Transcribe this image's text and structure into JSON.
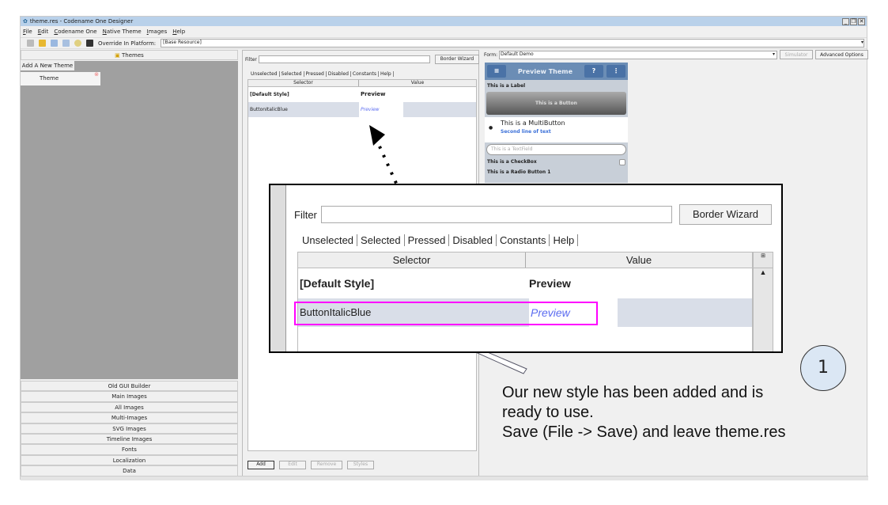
{
  "window": {
    "title": "theme.res - Codename One Designer",
    "controls": [
      "_",
      "❐",
      "✕"
    ]
  },
  "menu": [
    "File",
    "Edit",
    "Codename One",
    "Native Theme",
    "Images",
    "Help"
  ],
  "toolbar": {
    "platform_label": "Override In Platform:",
    "platform_value": "[Base Resource]"
  },
  "left": {
    "header": "Themes",
    "add_tab": "Add A New Theme",
    "theme_item": "Theme",
    "items": [
      "Old GUI Builder",
      "Main Images",
      "All Images",
      "Multi-Images",
      "SVG Images",
      "Timeline Images",
      "Fonts",
      "Localization",
      "Data"
    ]
  },
  "editor": {
    "filter_label": "Filter",
    "filter_value": "",
    "border_wizard": "Border Wizard",
    "tabs": [
      "Unselected",
      "Selected",
      "Pressed",
      "Disabled",
      "Constants",
      "Help"
    ],
    "columns": [
      "Selector",
      "Value"
    ],
    "rows": [
      {
        "selector": "[Default Style]",
        "value": "Preview"
      },
      {
        "selector": "ButtonItalicBlue",
        "value": "Preview"
      }
    ],
    "buttons": [
      "Add",
      "Edit",
      "Remove",
      "Styles"
    ]
  },
  "right": {
    "form_label": "Form:",
    "form_value": "Default Demo",
    "simulator": "Simulator",
    "advanced": "Advanced Options",
    "preview": {
      "title": "Preview Theme",
      "label": "This is a Label",
      "button": "This is a Button",
      "multibutton": "This is a MultiButton",
      "multibutton_line2": "Second line of text",
      "textfield_placeholder": "This is a TextField",
      "checkbox": "This is a CheckBox",
      "radio": "This is a Radio Button 1"
    }
  },
  "annotation": {
    "step": "1",
    "lines": [
      "Our new style has been added and is",
      "ready to use.",
      "Save (File -> Save) and leave theme.res"
    ]
  },
  "colors": {
    "titlebar": "#b9d1ea",
    "highlight": "#ff00ff",
    "preview_blue": "#5b6cf0",
    "selected_row": "#d9dee8"
  }
}
